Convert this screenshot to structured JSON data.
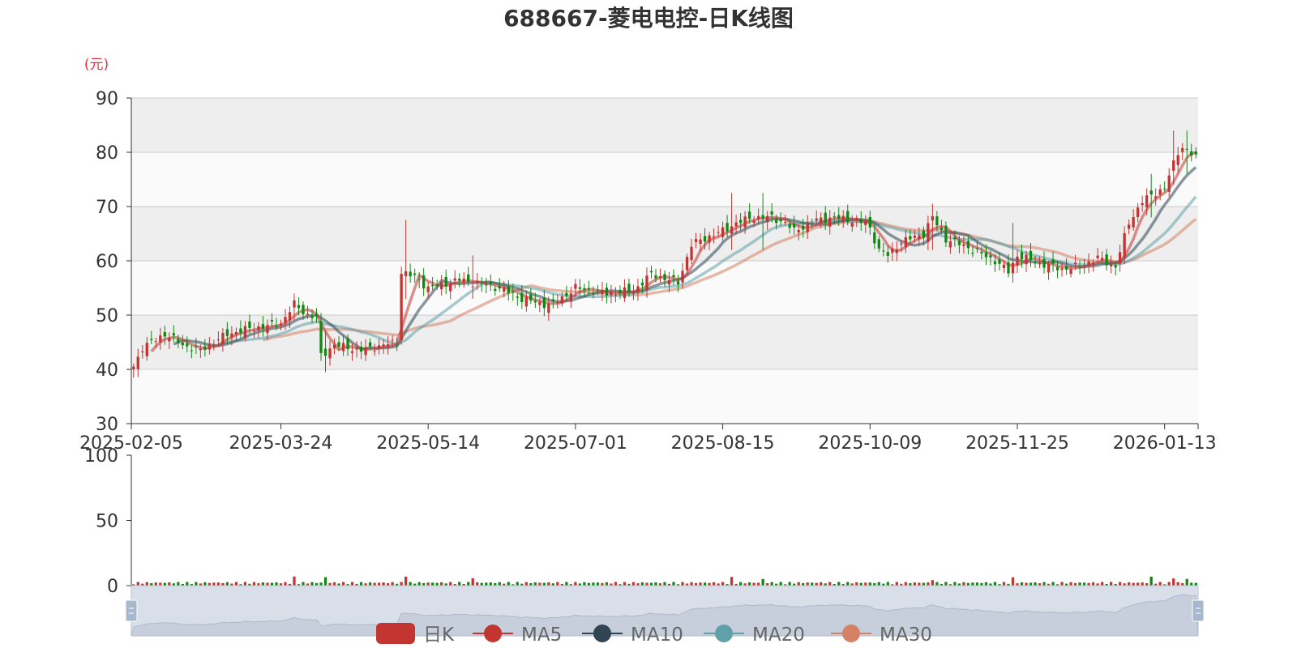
{
  "chart_data": {
    "type": "candlestick",
    "title": "688667-菱电电控-日K线图",
    "price_unit_label": "(元)",
    "price_axis": {
      "min": 30,
      "max": 90,
      "ticks": [
        30,
        40,
        50,
        60,
        70,
        80,
        90
      ]
    },
    "volume_axis": {
      "min": 0,
      "max": 100,
      "ticks": [
        0,
        50,
        100
      ]
    },
    "x_axis": {
      "start_date": "2025-02-05",
      "end_date": "2026-01-22",
      "tick_labels": [
        "2025-02-05",
        "2025-03-24",
        "2025-05-14",
        "2025-07-01",
        "2025-08-15",
        "2025-10-09",
        "2025-11-25",
        "2026-01-13"
      ]
    },
    "colors": {
      "up": "#c23531",
      "down": "#0f8a0f",
      "ma5": "#c23531",
      "ma10": "#2f4554",
      "ma20": "#61a0a8",
      "ma30": "#d48265"
    },
    "legend": {
      "position": "bottom-center",
      "items": [
        "日K",
        "MA5",
        "MA10",
        "MA20",
        "MA30"
      ]
    },
    "close_keypoints": [
      [
        "2025-02-05",
        40.5
      ],
      [
        "2025-02-07",
        44.0
      ],
      [
        "2025-02-14",
        46.5
      ],
      [
        "2025-02-20",
        44.5
      ],
      [
        "2025-02-26",
        43.5
      ],
      [
        "2025-03-06",
        46.5
      ],
      [
        "2025-03-13",
        47.5
      ],
      [
        "2025-03-19",
        48.0
      ],
      [
        "2025-03-24",
        48.5
      ],
      [
        "2025-03-27",
        52.0
      ],
      [
        "2025-04-01",
        50.0
      ],
      [
        "2025-04-03",
        49.5
      ],
      [
        "2025-04-07",
        42.5
      ],
      [
        "2025-04-10",
        44.5
      ],
      [
        "2025-04-18",
        43.5
      ],
      [
        "2025-04-25",
        44.5
      ],
      [
        "2025-04-30",
        45.0
      ],
      [
        "2025-05-06",
        58.0
      ],
      [
        "2025-05-09",
        57.0
      ],
      [
        "2025-05-14",
        55.0
      ],
      [
        "2025-05-23",
        56.5
      ],
      [
        "2025-05-28",
        56.0
      ],
      [
        "2025-06-06",
        55.0
      ],
      [
        "2025-06-13",
        53.0
      ],
      [
        "2025-06-20",
        52.0
      ],
      [
        "2025-06-24",
        52.0
      ],
      [
        "2025-07-01",
        55.0
      ],
      [
        "2025-07-10",
        54.0
      ],
      [
        "2025-07-18",
        54.5
      ],
      [
        "2025-07-24",
        57.5
      ],
      [
        "2025-08-01",
        56.0
      ],
      [
        "2025-08-06",
        63.0
      ],
      [
        "2025-08-12",
        64.5
      ],
      [
        "2025-08-15",
        65.5
      ],
      [
        "2025-08-20",
        67.0
      ],
      [
        "2025-08-26",
        68.0
      ],
      [
        "2025-09-01",
        68.0
      ],
      [
        "2025-09-04",
        67.0
      ],
      [
        "2025-09-08",
        65.5
      ],
      [
        "2025-09-15",
        67.5
      ],
      [
        "2025-09-19",
        68.0
      ],
      [
        "2025-09-30",
        67.0
      ],
      [
        "2025-10-09",
        66.0
      ],
      [
        "2025-10-13",
        62.0
      ],
      [
        "2025-10-15",
        61.0
      ],
      [
        "2025-10-20",
        63.5
      ],
      [
        "2025-10-27",
        65.0
      ],
      [
        "2025-10-29",
        68.0
      ],
      [
        "2025-11-03",
        64.0
      ],
      [
        "2025-11-10",
        62.5
      ],
      [
        "2025-11-18",
        60.0
      ],
      [
        "2025-11-21",
        58.0
      ],
      [
        "2025-11-25",
        61.0
      ],
      [
        "2025-12-02",
        59.5
      ],
      [
        "2025-12-09",
        58.5
      ],
      [
        "2025-12-15",
        59.0
      ],
      [
        "2025-12-19",
        60.5
      ],
      [
        "2025-12-25",
        59.0
      ],
      [
        "2025-12-30",
        67.0
      ],
      [
        "2026-01-06",
        71.0
      ],
      [
        "2026-01-13",
        73.5
      ],
      [
        "2026-01-16",
        80.0
      ],
      [
        "2026-01-19",
        81.0
      ],
      [
        "2026-01-22",
        79.0
      ]
    ],
    "spikes": [
      [
        "2025-03-27",
        54,
        49
      ],
      [
        "2025-04-08",
        47,
        39.5
      ],
      [
        "2025-05-07",
        67.5,
        53
      ],
      [
        "2025-05-28",
        61,
        53
      ],
      [
        "2025-08-19",
        72.5,
        62
      ],
      [
        "2025-08-28",
        72.5,
        62
      ],
      [
        "2025-10-29",
        70.5,
        62
      ],
      [
        "2025-11-24",
        67,
        56
      ],
      [
        "2026-01-08",
        76,
        68
      ],
      [
        "2026-01-15",
        84,
        74
      ],
      [
        "2026-01-20",
        84,
        76
      ]
    ]
  },
  "data_zoom": {
    "range_start_percent": 0,
    "range_end_percent": 100
  }
}
